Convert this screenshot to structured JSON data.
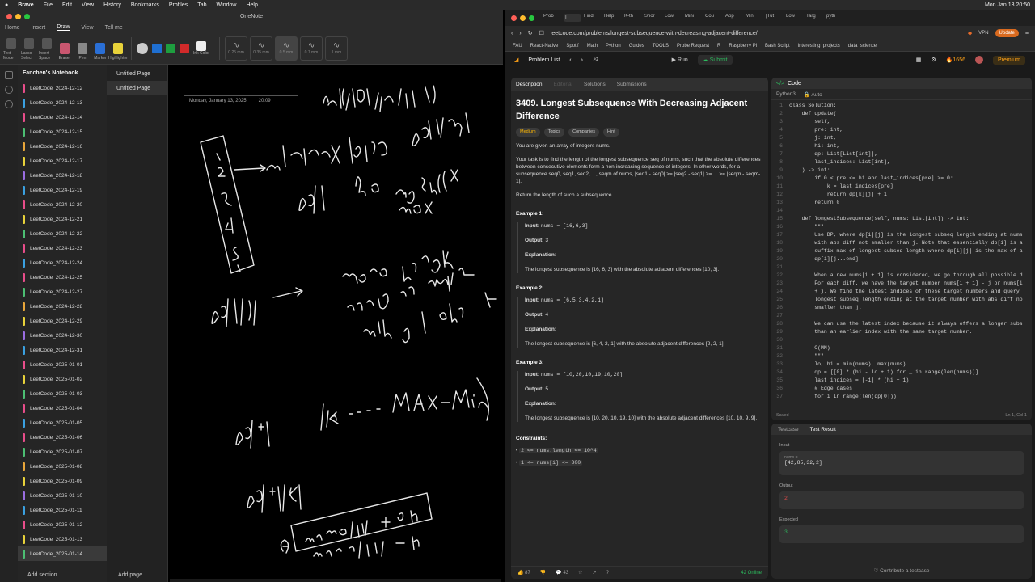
{
  "menubar": {
    "app": "Brave",
    "items": [
      "File",
      "Edit",
      "View",
      "History",
      "Bookmarks",
      "Profiles",
      "Tab",
      "Window",
      "Help"
    ],
    "clock": "Mon Jan 13  20:50"
  },
  "onenote": {
    "title": "OneNote",
    "tabs": [
      "Home",
      "Insert",
      "Draw",
      "View",
      "Tell me"
    ],
    "active_tab": "Draw",
    "ribbon_tools": [
      "Text Mode",
      "Lasso Select",
      "Insert Space",
      "Eraser",
      "Pen",
      "Marker",
      "Highlighter"
    ],
    "pen_sizes": [
      "0.25 mm",
      "0.35 mm",
      "0.5 mm",
      "0.7 mm",
      "1 mm"
    ],
    "ink_color": "Ink Color",
    "notebook": "Fanchen's Notebook",
    "sections": [
      {
        "name": "LeetCode_2024-12-12",
        "color": "#e84d8a"
      },
      {
        "name": "LeetCode_2024-12-13",
        "color": "#3aa0e0"
      },
      {
        "name": "LeetCode_2024-12-14",
        "color": "#e84d8a"
      },
      {
        "name": "LeetCode_2024-12-15",
        "color": "#4cbf73"
      },
      {
        "name": "LeetCode_2024-12-16",
        "color": "#e8a63a"
      },
      {
        "name": "LeetCode_2024-12-17",
        "color": "#e8d23a"
      },
      {
        "name": "LeetCode_2024-12-18",
        "color": "#9a6de0"
      },
      {
        "name": "LeetCode_2024-12-19",
        "color": "#3aa0e0"
      },
      {
        "name": "LeetCode_2024-12-20",
        "color": "#e84d8a"
      },
      {
        "name": "LeetCode_2024-12-21",
        "color": "#e8d23a"
      },
      {
        "name": "LeetCode_2024-12-22",
        "color": "#4cbf73"
      },
      {
        "name": "LeetCode_2024-12-23",
        "color": "#e84d8a"
      },
      {
        "name": "LeetCode_2024-12-24",
        "color": "#3aa0e0"
      },
      {
        "name": "LeetCode_2024-12-25",
        "color": "#e84d8a"
      },
      {
        "name": "LeetCode_2024-12-27",
        "color": "#4cbf73"
      },
      {
        "name": "LeetCode_2024-12-28",
        "color": "#e8a63a"
      },
      {
        "name": "LeetCode_2024-12-29",
        "color": "#e8d23a"
      },
      {
        "name": "LeetCode_2024-12-30",
        "color": "#9a6de0"
      },
      {
        "name": "LeetCode_2024-12-31",
        "color": "#3aa0e0"
      },
      {
        "name": "LeetCode_2025-01-01",
        "color": "#e84d8a"
      },
      {
        "name": "LeetCode_2025-01-02",
        "color": "#e8d23a"
      },
      {
        "name": "LeetCode_2025-01-03",
        "color": "#4cbf73"
      },
      {
        "name": "LeetCode_2025-01-04",
        "color": "#e84d8a"
      },
      {
        "name": "LeetCode_2025-01-05",
        "color": "#3aa0e0"
      },
      {
        "name": "LeetCode_2025-01-06",
        "color": "#e84d8a"
      },
      {
        "name": "LeetCode_2025-01-07",
        "color": "#4cbf73"
      },
      {
        "name": "LeetCode_2025-01-08",
        "color": "#e8a63a"
      },
      {
        "name": "LeetCode_2025-01-09",
        "color": "#e8d23a"
      },
      {
        "name": "LeetCode_2025-01-10",
        "color": "#9a6de0"
      },
      {
        "name": "LeetCode_2025-01-11",
        "color": "#3aa0e0"
      },
      {
        "name": "LeetCode_2025-01-12",
        "color": "#e84d8a"
      },
      {
        "name": "LeetCode_2025-01-13",
        "color": "#e8d23a"
      },
      {
        "name": "LeetCode_2025-01-14",
        "color": "#4cbf73"
      }
    ],
    "active_section": "LeetCode_2025-01-14",
    "pages": [
      "Untitled Page",
      "Untitled Page"
    ],
    "add_section": "Add section",
    "add_page": "Add page",
    "page_date": "Monday, January 13, 2025",
    "page_time": "20:09"
  },
  "browser": {
    "tabs": [
      "Prob",
      "I",
      "Find",
      "Help",
      "K-th",
      "Shor",
      "Low",
      "Mini",
      "Cou",
      "App",
      "Mini",
      "[Tut",
      "Low",
      "Targ",
      "pyth"
    ],
    "url": "leetcode.com/problems/longest-subsequence-with-decreasing-adjacent-difference/",
    "vpn": "VPN",
    "update": "Update",
    "bookmarks": [
      "FAU",
      "React-Native",
      "Spotif",
      "Math",
      "Python",
      "Guides",
      "TOOLS",
      "Probe Request",
      "R",
      "Raspberry Pi",
      "Bash Script",
      "interesting_projects",
      "data_science"
    ]
  },
  "leetcode": {
    "problem_list": "Problem List",
    "run": "Run",
    "submit": "Submit",
    "streak": "1656",
    "premium": "Premium",
    "desc_tabs": [
      "Description",
      "Editorial",
      "Solutions",
      "Submissions"
    ],
    "title": "3409. Longest Subsequence With Decreasing Adjacent Difference",
    "difficulty": "Medium",
    "chips": [
      "Topics",
      "Companies",
      "Hint"
    ],
    "p1": "You are given an array of integers nums.",
    "p2": "Your task is to find the length of the longest subsequence seq of nums, such that the absolute differences between consecutive elements form a non-increasing sequence of integers. In other words, for a subsequence seq0, seq1, seq2, ..., seqm of nums, |seq1 - seq0| >= |seq2 - seq1| >= ... >= |seqm - seqm-1|.",
    "p3": "Return the length of such a subsequence.",
    "examples": [
      {
        "title": "Example 1:",
        "input": "nums = [16,6,3]",
        "output": "3",
        "explanation": "The longest subsequence is [16, 6, 3] with the absolute adjacent differences [10, 3]."
      },
      {
        "title": "Example 2:",
        "input": "nums = [6,5,3,4,2,1]",
        "output": "4",
        "explanation": "The longest subsequence is [6, 4, 2, 1] with the absolute adjacent differences [2, 2, 1]."
      },
      {
        "title": "Example 3:",
        "input": "nums = [10,20,10,19,10,20]",
        "output": "5",
        "explanation": "The longest subsequence is [10, 20, 10, 19, 10] with the absolute adjacent differences [10, 10, 9, 9]."
      }
    ],
    "labels": {
      "input": "Input:",
      "output": "Output:",
      "explanation": "Explanation:"
    },
    "constraints_title": "Constraints:",
    "constraints": [
      "2 <= nums.length <= 10^4",
      "1 <= nums[i] <= 300"
    ],
    "likes": "87",
    "comments": "43",
    "online": "42 Online",
    "code_tab": "Code",
    "language": "Python3",
    "auto": "Auto",
    "code_lines": [
      {
        "n": "1",
        "t": "class Solution:",
        "k": "kw"
      },
      {
        "n": "2",
        "t": "    def update(",
        "k": ""
      },
      {
        "n": "3",
        "t": "        self,",
        "k": ""
      },
      {
        "n": "4",
        "t": "        pre: int,",
        "k": ""
      },
      {
        "n": "5",
        "t": "        j: int,",
        "k": ""
      },
      {
        "n": "6",
        "t": "        hi: int,",
        "k": ""
      },
      {
        "n": "7",
        "t": "        dp: List[List[int]],",
        "k": ""
      },
      {
        "n": "8",
        "t": "        last_indices: List[int],",
        "k": ""
      },
      {
        "n": "9",
        "t": "    ) -> int:",
        "k": ""
      },
      {
        "n": "10",
        "t": "        if 0 < pre <= hi and last_indices[pre] >= 0:",
        "k": ""
      },
      {
        "n": "11",
        "t": "            k = last_indices[pre]",
        "k": ""
      },
      {
        "n": "12",
        "t": "            return dp[k][j] + 1",
        "k": ""
      },
      {
        "n": "13",
        "t": "        return 0",
        "k": ""
      },
      {
        "n": "14",
        "t": "",
        "k": ""
      },
      {
        "n": "15",
        "t": "    def longestSubsequence(self, nums: List[int]) -> int:",
        "k": ""
      },
      {
        "n": "16",
        "t": "        \"\"\"",
        "k": "cm"
      },
      {
        "n": "17",
        "t": "        Use DP, where dp[i][j] is the longest subseq length ending at nums",
        "k": "cm"
      },
      {
        "n": "18",
        "t": "        with abs diff not smaller than j. Note that essentially dp[i] is a",
        "k": "cm"
      },
      {
        "n": "19",
        "t": "        suffix max of longest subseq length where dp[i][j] is the max of a",
        "k": "cm"
      },
      {
        "n": "20",
        "t": "        dp[i][j...end]",
        "k": "cm"
      },
      {
        "n": "21",
        "t": "",
        "k": ""
      },
      {
        "n": "22",
        "t": "        When a new nums[i + 1] is considered, we go through all possible d",
        "k": "cm"
      },
      {
        "n": "23",
        "t": "        For each diff, we have the target number nums[i + 1] - j or nums[i",
        "k": "cm"
      },
      {
        "n": "24",
        "t": "        + j. We find the latest indices of these target numbers and query",
        "k": "cm"
      },
      {
        "n": "25",
        "t": "        longest subseq length ending at the target number with abs diff no",
        "k": "cm"
      },
      {
        "n": "26",
        "t": "        smaller than j.",
        "k": "cm"
      },
      {
        "n": "27",
        "t": "",
        "k": ""
      },
      {
        "n": "28",
        "t": "        We can use the latest index because it always offers a longer subs",
        "k": "cm"
      },
      {
        "n": "29",
        "t": "        than an earlier index with the same target number.",
        "k": "cm"
      },
      {
        "n": "30",
        "t": "",
        "k": ""
      },
      {
        "n": "31",
        "t": "        O(MN)",
        "k": "cm"
      },
      {
        "n": "32",
        "t": "        \"\"\"",
        "k": "cm"
      },
      {
        "n": "33",
        "t": "        lo, hi = min(nums), max(nums)",
        "k": ""
      },
      {
        "n": "34",
        "t": "        dp = [[0] * (hi - lo + 1) for _ in range(len(nums))]",
        "k": ""
      },
      {
        "n": "35",
        "t": "        last_indices = [-1] * (hi + 1)",
        "k": ""
      },
      {
        "n": "36",
        "t": "        # Edge cases",
        "k": "cm"
      },
      {
        "n": "37",
        "t": "        for i in range(len(dp[0])):",
        "k": ""
      }
    ],
    "saved": "Saved",
    "cursor_pos": "Ln 1, Col 1",
    "test_tabs": [
      "Testcase",
      "Test Result"
    ],
    "input_label": "Input",
    "input_sub": "nums =",
    "input_value": "[42,85,32,2]",
    "output_label": "Output",
    "output_value": "2",
    "expected_label": "Expected",
    "expected_value": "3",
    "contribute": "Contribute a testcase"
  }
}
